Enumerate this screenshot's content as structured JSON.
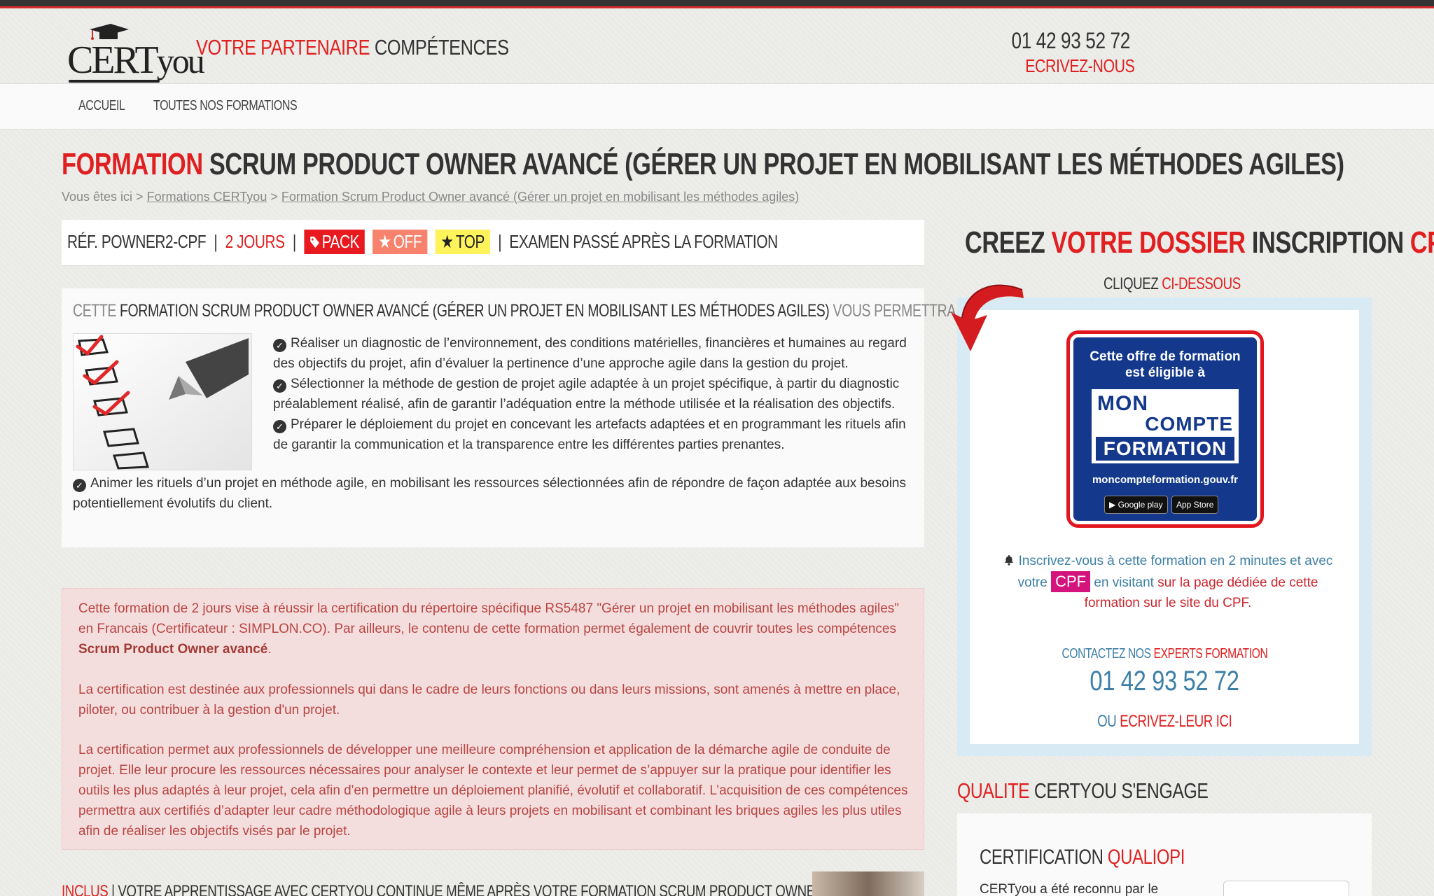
{
  "brand": {
    "logo_text_main": "CERT",
    "logo_text_small": "you",
    "tagline_red": "VOTRE PARTENAIRE",
    "tagline_dark": "COMPÉTENCES"
  },
  "contact_header": {
    "phone": "01 42 93 52 72",
    "email_label": "ECRIVEZ-NOUS"
  },
  "nav": [
    {
      "label": "ACCUEIL"
    },
    {
      "label": "TOUTES NOS FORMATIONS"
    }
  ],
  "page": {
    "title_red": "FORMATION",
    "title_rest": "SCRUM PRODUCT OWNER AVANCÉ (GÉRER UN PROJET EN MOBILISANT LES MÉTHODES AGILES)",
    "breadcrumb_prefix": "Vous êtes ici >",
    "breadcrumb_link1": "Formations CERTyou",
    "breadcrumb_sep": ">",
    "breadcrumb_link2": "Formation Scrum Product Owner avancé (Gérer un projet en mobilisant les méthodes agiles)"
  },
  "refbar": {
    "ref": "RÉF. POWNER2-CPF",
    "sep": "|",
    "duration": "2 JOURS",
    "badge_pack": "PACK",
    "badge_off": "OFF",
    "badge_top": "TOP",
    "exam": "EXAMEN PASSÉ APRÈS LA FORMATION"
  },
  "objectives": {
    "head_pre": "CETTE",
    "head_bold": "FORMATION SCRUM PRODUCT OWNER AVANCÉ (GÉRER UN PROJET EN MOBILISANT LES MÉTHODES AGILES)",
    "head_post": "VOUS PERMETTRA DE :",
    "items": [
      "Réaliser un diagnostic de l’environnement, des conditions matérielles, financières et humaines au regard des objectifs du projet, afin d’évaluer la pertinence d’une approche agile dans la gestion du projet.",
      "Sélectionner la méthode de gestion de projet agile adaptée à un projet spécifique, à partir du diagnostic préalablement réalisé, afin de garantir l’adéquation entre la méthode utilisée et la réalisation des objectifs.",
      "Préparer le déploiement du projet en concevant les artefacts adaptées et en programmant les rituels afin de garantir la communication et la transparence entre les différentes parties prenantes.",
      "Animer les rituels d’un projet en méthode agile, en mobilisant les ressources sélectionnées afin de répondre de façon adaptée aux besoins potentiellement évolutifs du client."
    ]
  },
  "certification": {
    "p1_pre": "Cette formation de 2 jours vise à réussir la certification du répertoire spécifique RS5487 \"Gérer un projet en mobilisant les méthodes agiles\" en Francais (Certificateur : SIMPLON.CO). Par ailleurs, le contenu de cette formation permet également de couvrir toutes les compétences",
    "p1_bold": "Scrum Product Owner avancé",
    "p1_post": ".",
    "p2": "La certification est destinée aux professionnels qui dans le cadre de leurs fonctions ou dans leurs missions, sont amenés à mettre en place, piloter, ou contribuer à la gestion d'un projet.",
    "p3": "La certification permet aux professionnels de développer une meilleure compréhension et application de la démarche agile de conduite de projet. Elle leur procure les ressources nécessaires pour analyser le contexte et leur permet de s’appuyer sur la pratique pour identifier les outils les plus adaptés à leur projet, cela afin d'en permettre un déploiement planifié, évolutif et collaboratif. L’acquisition de ces compétences permettra aux certifiés d’adapter leur cadre méthodologique agile à leurs projets en mobilisant et combinant les briques agiles les plus utiles afin de réaliser les objectifs visés par le projet."
  },
  "inclus": {
    "red": "INCLUS",
    "rest": "| VOTRE APPRENTISSAGE AVEC CERTYOU CONTINUE MÊME APRÈS VOTRE FORMATION SCRUM PRODUCT OWNER AVANCÉ"
  },
  "cpf_panel": {
    "title_1": "CREEZ",
    "title_2": "VOTRE DOSSIER",
    "title_3": "INSCRIPTION",
    "title_4": "CPF",
    "cliquez_1": "CLIQUEZ",
    "cliquez_2": "CI-DESSOUS",
    "mcf_eligible_1": "Cette offre de formation",
    "mcf_eligible_2": "est éligible à",
    "mcf_w1": "MON",
    "mcf_w2": "COMPTE",
    "mcf_w3": "FORMATION",
    "mcf_url": "moncompteformation.gouv.fr",
    "store_google": "▶ Google play",
    "store_apple": " App Store",
    "text_1": "Inscrivez-vous à cette formation en 2 minutes et avec votre",
    "text_tag": "CPF",
    "text_2": "en visitant",
    "text_red": "sur la page dédiée de cette formation sur le site du CPF.",
    "contact_1": "CONTACTEZ NOS",
    "contact_2": "EXPERTS FORMATION",
    "phone": "01 42 93 52 72",
    "ou": "OU",
    "ecrivez": "ECRIVEZ-LEUR ICI"
  },
  "qualite": {
    "title_red": "QUALITE",
    "title_rest": "CERTYOU S'ENGAGE",
    "cert_dark": "CERTIFICATION",
    "cert_red": "QUALIOPI",
    "text": "CERTyou a été reconnu par le"
  }
}
